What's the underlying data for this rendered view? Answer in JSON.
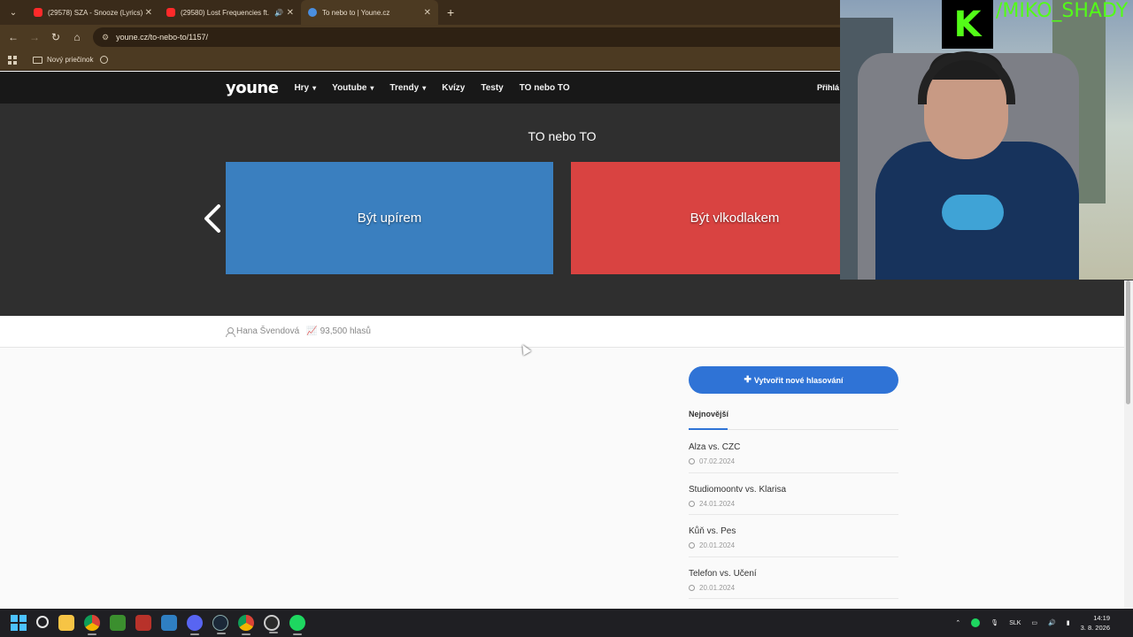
{
  "browser": {
    "tabs": [
      {
        "title": "(29578) SZA - Snooze (Lyrics) -",
        "favicon": "youtube-icon",
        "active": false
      },
      {
        "title": "(29580) Lost Frequencies ft.",
        "favicon": "youtube-icon",
        "active": false,
        "audio": true
      },
      {
        "title": "To nebo to | Youne.cz",
        "favicon": "youne-icon",
        "active": true
      }
    ],
    "new_tab": "+",
    "url": "youne.cz/to-nebo-to/1157/",
    "bookmarks": [
      {
        "label": "Nový priečinok"
      }
    ]
  },
  "site": {
    "logo": "youne",
    "nav": [
      {
        "label": "Hry",
        "dropdown": true
      },
      {
        "label": "Youtube",
        "dropdown": true
      },
      {
        "label": "Trendy",
        "dropdown": true
      },
      {
        "label": "Kvízy",
        "dropdown": false
      },
      {
        "label": "Testy",
        "dropdown": false
      },
      {
        "label": "TO nebo TO",
        "dropdown": false
      }
    ],
    "login": "Přihlá"
  },
  "hero": {
    "title": "TO nebo TO",
    "option_a": "Být upírem",
    "option_b": "Být vlkodlakem"
  },
  "meta": {
    "author": "Hana Švendová",
    "votes": "93,500 hlasů"
  },
  "sidebar": {
    "create_label": "Vytvořit nové hlasování",
    "tab_label": "Nejnovější",
    "items": [
      {
        "title": "Alza vs. CZC",
        "date": "07.02.2024"
      },
      {
        "title": "Studiomoontv vs. Klarisa",
        "date": "24.01.2024"
      },
      {
        "title": "Kůň vs. Pes",
        "date": "20.01.2024"
      },
      {
        "title": "Telefon vs. Učení",
        "date": "20.01.2024"
      }
    ]
  },
  "webcam": {
    "streamer": "/MIKO_SHADY",
    "logo_letter": "K"
  },
  "taskbar": {
    "lang": "SLK",
    "time": "14:19",
    "date": "3. 8. 2026"
  },
  "colors": {
    "option_a": "#3a7fbf",
    "option_b": "#d94341",
    "accent": "#2f73d6",
    "kick_green": "#53fc18"
  }
}
